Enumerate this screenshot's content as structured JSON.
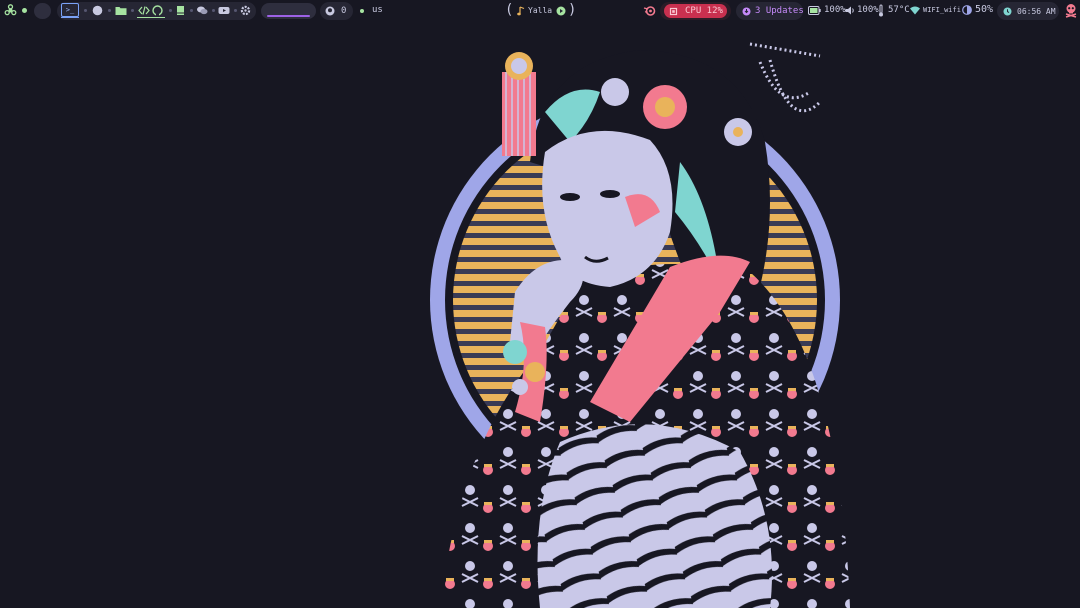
{
  "workspace_icons": {
    "terminal": ">_",
    "items": [
      "firefox-icon",
      "files-icon",
      "code-icon",
      "github-icon",
      "notes-icon",
      "chat-icon",
      "youtube-icon",
      "settings-icon"
    ]
  },
  "github": {
    "count": "0"
  },
  "keyboard": {
    "layout": "us"
  },
  "media": {
    "title": "Yalla"
  },
  "cpu": {
    "label": "CPU 12%"
  },
  "updates": {
    "label": "3 Updates"
  },
  "battery": {
    "label": "100%"
  },
  "volume": {
    "label": "100%"
  },
  "temperature": {
    "label": "57°C"
  },
  "wifi": {
    "label": "WIFI_wifi"
  },
  "brightness": {
    "label": "50%"
  },
  "clock": {
    "label": "06:56 AM"
  },
  "colors": {
    "bg": "#171722",
    "module": "#262634",
    "accent_green": "#a6e3a1",
    "accent_pink": "#f27a8f",
    "accent_purple": "#c58af9",
    "cpu_bg": "#d23a5a",
    "sun_stripes": "#e9b35b",
    "ring": "#9fa6e8"
  }
}
